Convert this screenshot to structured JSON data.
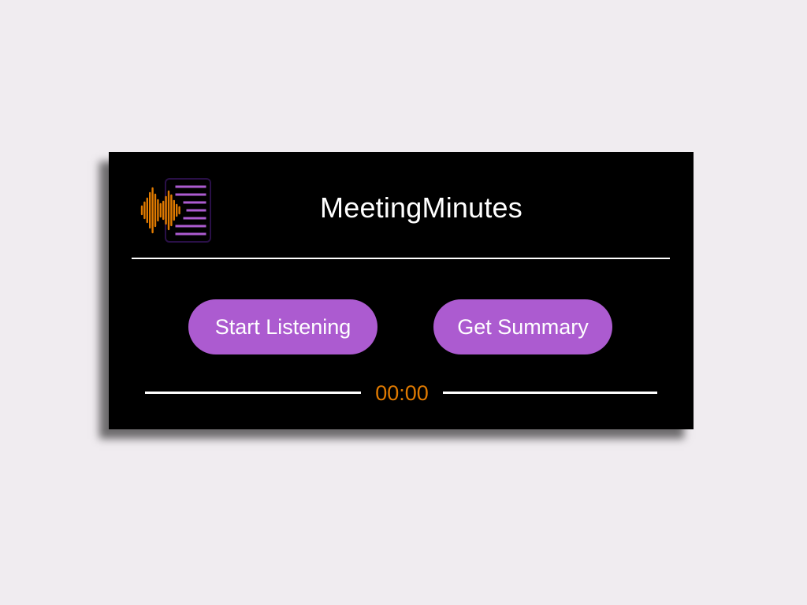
{
  "app": {
    "title": "MeetingMinutes",
    "logo_icon": "waveform-document-icon"
  },
  "buttons": {
    "start_label": "Start Listening",
    "summary_label": "Get Summary"
  },
  "timer": {
    "value": "00:00"
  },
  "colors": {
    "page_background": "#f0ecf0",
    "panel_background": "#000000",
    "accent_purple": "#ac5bd0",
    "accent_orange": "#e07a00",
    "text": "#ffffff"
  }
}
